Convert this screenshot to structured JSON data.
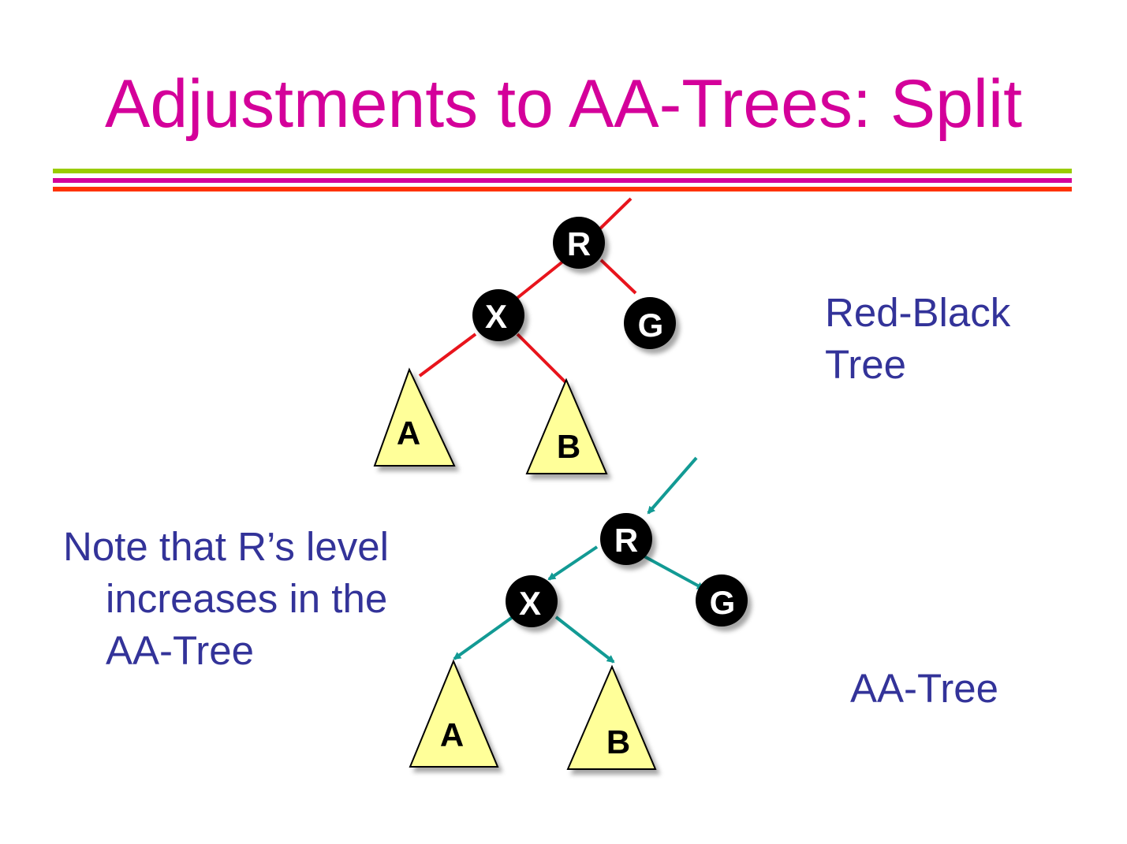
{
  "title": "Adjustments to AA-Trees: Split",
  "colors": {
    "title": "#d4009a",
    "rule_top": "#99cc00",
    "rule_middle": "#d4009a",
    "rule_bottom": "#ff3300",
    "red_link": "#e8141c",
    "aa_link": "#129a94",
    "node_fill": "#000000",
    "subtree_fill": "#ffff99",
    "text": "#333399"
  },
  "red_black_tree": {
    "caption": "Red-Black Tree",
    "nodes": {
      "root": "R",
      "left": "X",
      "right": "G"
    },
    "subtrees": {
      "left": "A",
      "right": "B"
    }
  },
  "aa_tree": {
    "caption": "AA-Tree",
    "nodes": {
      "root": "R",
      "left": "X",
      "right": "G"
    },
    "subtrees": {
      "left": "A",
      "right": "B"
    }
  },
  "note": "Note that R’s level increases in the AA-Tree"
}
